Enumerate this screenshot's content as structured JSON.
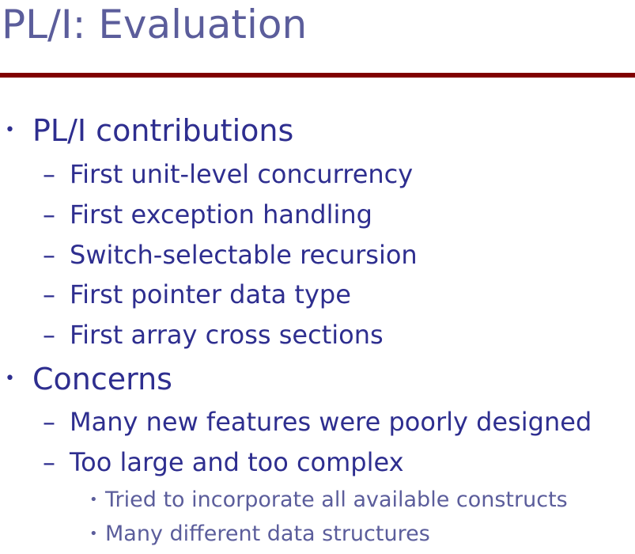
{
  "slide": {
    "title": "PL/I: Evaluation",
    "accent_color": "#800000",
    "text_color": "#2e2e8f",
    "title_color": "#5b5d9b",
    "bullets": [
      {
        "text": "PL/I contributions",
        "items": [
          {
            "text": "First unit-level concurrency"
          },
          {
            "text": "First exception handling"
          },
          {
            "text": "Switch-selectable recursion"
          },
          {
            "text": "First pointer data type"
          },
          {
            "text": "First array cross sections"
          }
        ]
      },
      {
        "text": "Concerns",
        "items": [
          {
            "text": "Many new features were poorly designed"
          },
          {
            "text": "Too large and too complex",
            "subitems": [
              {
                "text": "Tried to incorporate all available constructs"
              },
              {
                "text": "Many different data structures"
              }
            ]
          }
        ]
      }
    ]
  }
}
